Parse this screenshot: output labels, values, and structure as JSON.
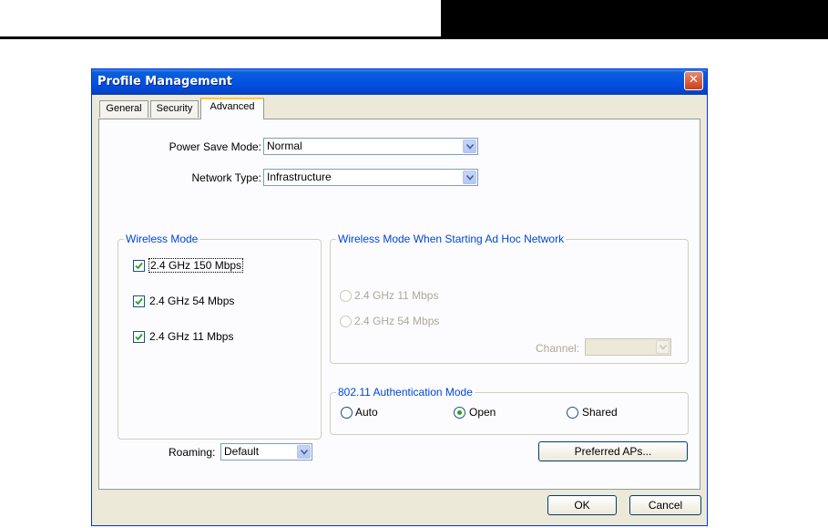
{
  "window": {
    "title": "Profile Management",
    "close_label": "✕"
  },
  "tabs": [
    {
      "label": "General"
    },
    {
      "label": "Security"
    },
    {
      "label": "Advanced",
      "active": true
    }
  ],
  "power_save": {
    "label": "Power Save Mode:",
    "value": "Normal"
  },
  "network_type": {
    "label": "Network Type:",
    "value": "Infrastructure"
  },
  "wireless_mode": {
    "legend": "Wireless Mode",
    "options": [
      {
        "label": "2.4 GHz 150 Mbps",
        "checked": true
      },
      {
        "label": "2.4 GHz 54 Mbps",
        "checked": true
      },
      {
        "label": "2.4 GHz 11 Mbps",
        "checked": true
      }
    ]
  },
  "adhoc": {
    "legend": "Wireless Mode When Starting Ad Hoc Network",
    "options": [
      {
        "label": "2.4 GHz 11 Mbps"
      },
      {
        "label": "2.4 GHz 54 Mbps"
      }
    ],
    "channel_label": "Channel:",
    "channel_value": ""
  },
  "auth": {
    "legend": "802.11 Authentication Mode",
    "options": [
      {
        "label": "Auto",
        "selected": false
      },
      {
        "label": "Open",
        "selected": true
      },
      {
        "label": "Shared",
        "selected": false
      }
    ]
  },
  "roaming": {
    "label": "Roaming:",
    "value": "Default"
  },
  "buttons": {
    "preferred_aps": "Preferred APs...",
    "ok": "OK",
    "cancel": "Cancel"
  },
  "colors": {
    "titlebar": "#0554e3",
    "group_legend": "#0046d5",
    "close_button": "#c6411c",
    "radio_dot": "#21a121",
    "dialog_bg": "#ece9d8"
  }
}
